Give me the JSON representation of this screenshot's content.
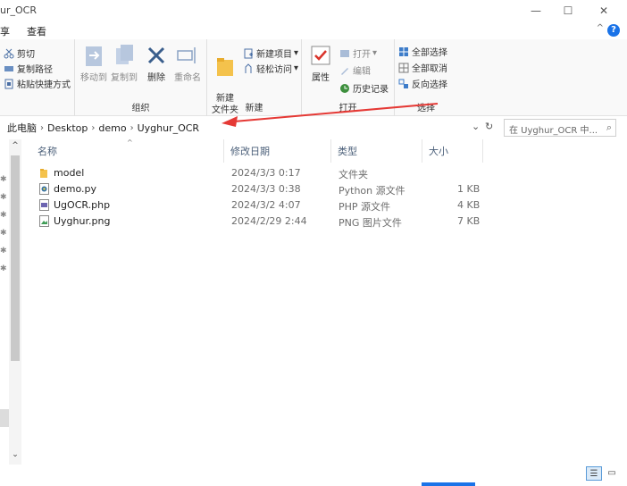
{
  "window": {
    "title": "ur_OCR",
    "minimize": "—",
    "maximize": "☐",
    "close": "✕"
  },
  "menu": {
    "tabs": [
      "享",
      "查看"
    ],
    "collapse": "^",
    "help": "?"
  },
  "ribbon": {
    "clipboard": {
      "cut": "剪切",
      "copy_path": "复制路径",
      "paste_shortcut": "粘贴快捷方式",
      "label": ""
    },
    "organize": {
      "move_to": "移动到",
      "copy_to": "复制到",
      "delete": "删除",
      "rename": "重命名",
      "label": "组织"
    },
    "new": {
      "new_folder": "新建\n文件夹",
      "new_item": "新建项目",
      "easy_access": "轻松访问",
      "label": "新建"
    },
    "open": {
      "properties": "属性",
      "open": "打开",
      "edit": "编辑",
      "history": "历史记录",
      "label": "打开"
    },
    "select": {
      "select_all": "全部选择",
      "select_none": "全部取消",
      "invert": "反向选择",
      "label": "选择"
    }
  },
  "address": {
    "crumbs": [
      "此电脑",
      "Desktop",
      "demo",
      "Uyghur_OCR"
    ],
    "dropdown": "⌄",
    "refresh": "↻",
    "search_placeholder": "在 Uyghur_OCR 中...",
    "search_icon": "⌕"
  },
  "columns": {
    "name": "名称",
    "modified": "修改日期",
    "type": "类型",
    "size": "大小"
  },
  "files": [
    {
      "name": "model",
      "modified": "2024/3/3 0:17",
      "type": "文件夹",
      "size": "",
      "icon": "folder-icon"
    },
    {
      "name": "demo.py",
      "modified": "2024/3/3 0:38",
      "type": "Python 源文件",
      "size": "1 KB",
      "icon": "python-file-icon"
    },
    {
      "name": "UgOCR.php",
      "modified": "2024/3/2 4:07",
      "type": "PHP 源文件",
      "size": "4 KB",
      "icon": "php-file-icon"
    },
    {
      "name": "Uyghur.png",
      "modified": "2024/2/29 2:44",
      "type": "PNG 图片文件",
      "size": "7 KB",
      "icon": "image-file-icon"
    }
  ],
  "scroll": {
    "up": "^",
    "down": "⌄"
  },
  "colors": {
    "accent": "#1a73e8",
    "annotation_arrow": "#e53935",
    "folder": "#f4c24c"
  }
}
